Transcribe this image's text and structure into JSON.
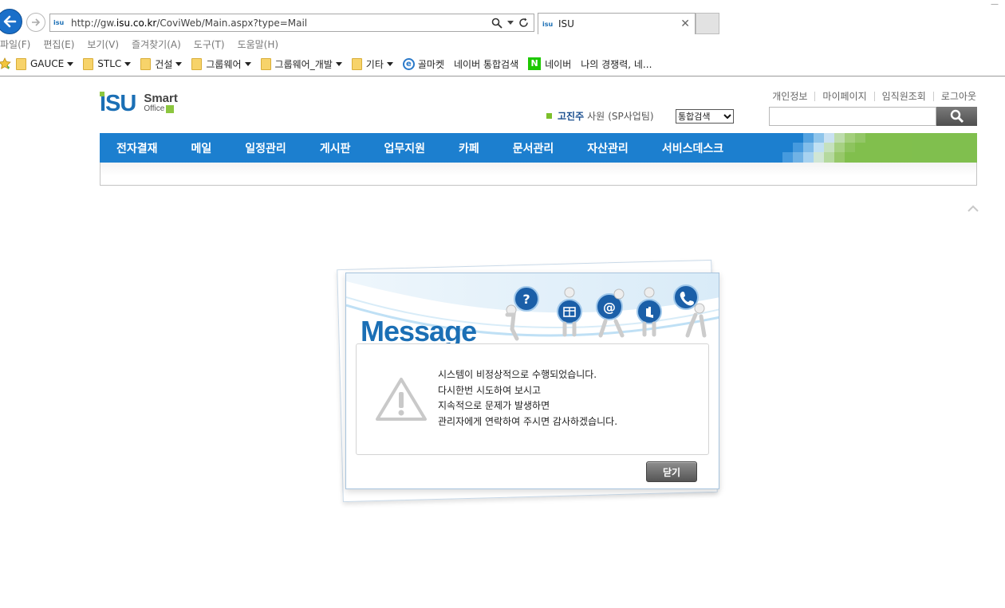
{
  "browser": {
    "url_prefix": "http://gw.",
    "url_domain": "isu.co.kr",
    "url_path": "/CoviWeb/Main.aspx?type=Mail",
    "favicon_text": "isu",
    "tab_title": "ISU",
    "menu": [
      "파일(F)",
      "편집(E)",
      "보기(V)",
      "즐겨찾기(A)",
      "도구(T)",
      "도움말(H)"
    ],
    "favorites": [
      {
        "label": "GAUCE",
        "type": "folder",
        "dropdown": true
      },
      {
        "label": "STLC",
        "type": "folder",
        "dropdown": true
      },
      {
        "label": "건설",
        "type": "folder",
        "dropdown": true
      },
      {
        "label": "그룹웨어",
        "type": "folder",
        "dropdown": true
      },
      {
        "label": "그룹웨어_개발",
        "type": "folder",
        "dropdown": true
      },
      {
        "label": "기타",
        "type": "folder",
        "dropdown": true
      },
      {
        "label": "골마켓",
        "type": "ie-link",
        "dropdown": false
      },
      {
        "label": "네이버 통합검색",
        "type": "text",
        "dropdown": false
      },
      {
        "label": "네이버",
        "type": "naver-link",
        "dropdown": false
      },
      {
        "label": "나의 경쟁력, 네...",
        "type": "text",
        "dropdown": false
      }
    ]
  },
  "site": {
    "logo_main": "ISU",
    "logo_smart": "Smart",
    "logo_office": "Office",
    "top_links": [
      "개인정보",
      "마이페이지",
      "임직원조회",
      "로그아웃"
    ],
    "user_name": "고진주",
    "user_rank": "사원",
    "user_dept": "(SP사업팀)",
    "search_scope": "통합검색",
    "search_value": "",
    "nav": [
      "전자결재",
      "메일",
      "일정관리",
      "게시판",
      "업무지원",
      "카페",
      "문서관리",
      "자산관리",
      "서비스데스크"
    ],
    "colors": {
      "nav_blue": "#1c7fcf",
      "brand_green": "#8cc63f",
      "brand_blue": "#1b6fb5"
    }
  },
  "dialog": {
    "title": "Message",
    "lines": [
      "시스템이 비정상적으로 수행되었습니다.",
      "다시한번 시도하여 보시고",
      "지속적으로 문제가 발생하면",
      "관리자에게 연락하여 주시면 감사하겠습니다."
    ],
    "close_label": "닫기",
    "icon": "warning-icon"
  }
}
